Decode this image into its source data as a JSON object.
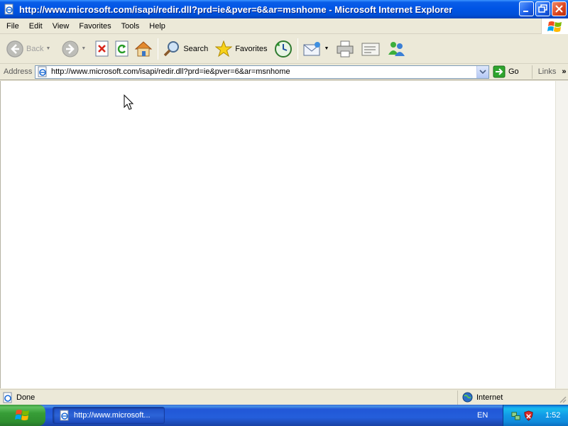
{
  "window": {
    "title": "http://www.microsoft.com/isapi/redir.dll?prd=ie&pver=6&ar=msnhome - Microsoft Internet Explorer"
  },
  "menu": {
    "items": [
      "File",
      "Edit",
      "View",
      "Favorites",
      "Tools",
      "Help"
    ]
  },
  "toolbar": {
    "back_label": "Back",
    "search_label": "Search",
    "favorites_label": "Favorites"
  },
  "address": {
    "label": "Address",
    "url": "http://www.microsoft.com/isapi/redir.dll?prd=ie&pver=6&ar=msnhome",
    "go_label": "Go",
    "links_label": "Links"
  },
  "status": {
    "text": "Done",
    "zone": "Internet"
  },
  "taskbar": {
    "task_label": "http://www.microsoft...",
    "language": "EN",
    "clock": "1:52"
  },
  "colors": {
    "titlebar": "#0055e5",
    "taskbar": "#245edb",
    "start": "#379d37",
    "chrome": "#ece9d8"
  }
}
